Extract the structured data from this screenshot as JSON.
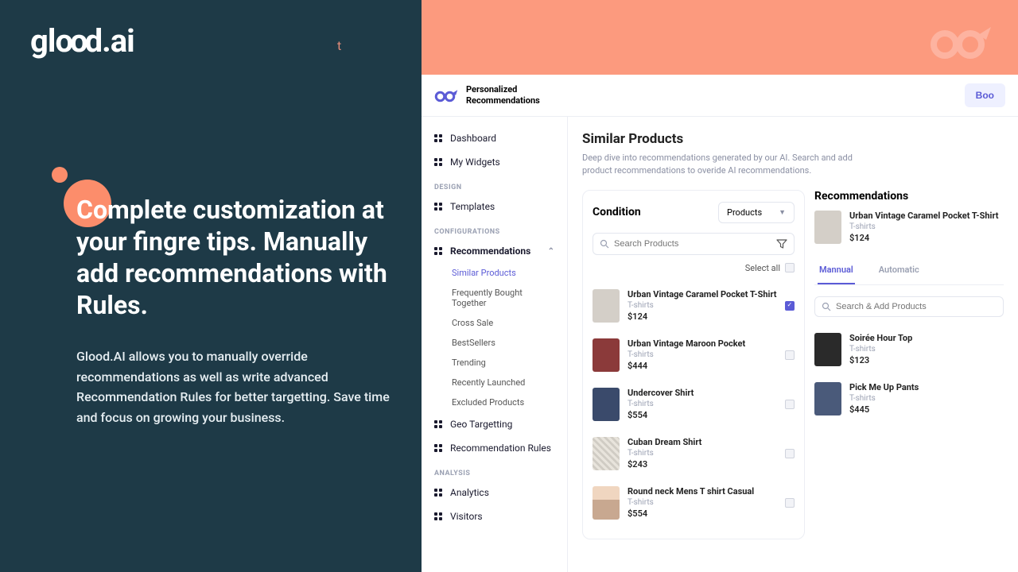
{
  "hero": {
    "logo": "glood.ai",
    "t": "t",
    "headline": "Complete customization at your fingre tips. Manually add recommendations with Rules.",
    "body": "Glood.AI allows you to manually override recommendations as well as write advanced Recommendation Rules for better targetting. Save time and focus on growing your business."
  },
  "app": {
    "title_l1": "Personalized",
    "title_l2": "Recommendations",
    "cta": "Boo"
  },
  "nav": {
    "dashboard": "Dashboard",
    "my_widgets": "My Widgets",
    "section_design": "DESIGN",
    "templates": "Templates",
    "section_config": "CONFIGURATIONS",
    "recommendations": "Recommendations",
    "subs": {
      "similar": "Similar Products",
      "fbt": "Frequently Bought Together",
      "cross": "Cross Sale",
      "best": "BestSellers",
      "trending": "Trending",
      "recent": "Recently Launched",
      "excluded": "Excluded Products"
    },
    "geo": "Geo Targetting",
    "rules": "Recommendation Rules",
    "section_analysis": "ANALYSIS",
    "analytics": "Analytics",
    "visitors": "Visitors"
  },
  "main": {
    "title": "Similar Products",
    "sub": "Deep dive into recommendations generated by our AI. Search and add product recommendations to overide AI recommendations."
  },
  "cond": {
    "title": "Condition",
    "dropdown": "Products",
    "search_ph": "Search Products",
    "select_all": "Select all",
    "items": [
      {
        "name": "Urban Vintage Caramel Pocket T-Shirt",
        "cat": "T-shirts",
        "price": "$124",
        "thumb": "caramel",
        "checked": true
      },
      {
        "name": "Urban Vintage Maroon Pocket",
        "cat": "T-shirts",
        "price": "$444",
        "thumb": "maroon"
      },
      {
        "name": "Undercover Shirt",
        "cat": "T-shirts",
        "price": "$554",
        "thumb": "navy"
      },
      {
        "name": "Cuban Dream Shirt",
        "cat": "T-shirts",
        "price": "$243",
        "thumb": "pattern"
      },
      {
        "name": "Round neck Mens T shirt Casual",
        "cat": "T-shirts",
        "price": "$554",
        "thumb": "person"
      }
    ]
  },
  "rec": {
    "title": "Recommendations",
    "selected": {
      "name": "Urban Vintage Caramel Pocket T-Shirt",
      "cat": "T-shirts",
      "price": "$124"
    },
    "tab_manual": "Mannual",
    "tab_auto": "Automatic",
    "search_ph": "Search & Add Products",
    "items": [
      {
        "name": "Soirée Hour Top",
        "cat": "T-shirts",
        "price": "$123",
        "thumb": "black"
      },
      {
        "name": "Pick Me Up Pants",
        "cat": "T-shirts",
        "price": "$445",
        "thumb": "pants"
      }
    ]
  }
}
